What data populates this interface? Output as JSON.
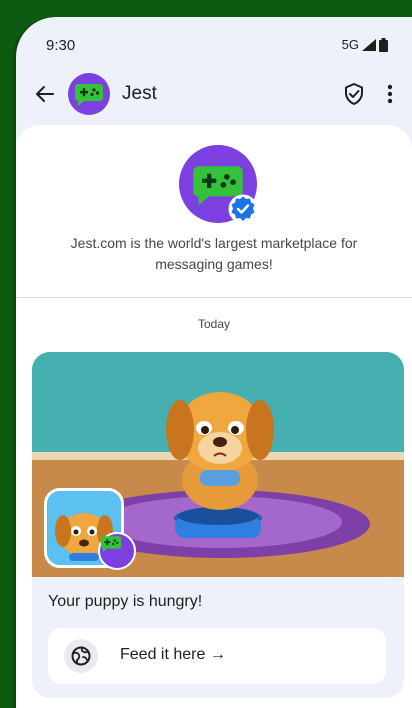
{
  "status_bar": {
    "time": "9:30",
    "network": "5G",
    "signal_icon": "signal-icon",
    "battery_icon": "battery-icon"
  },
  "appbar": {
    "title": "Jest",
    "back_icon": "arrow-back-icon",
    "shield_icon": "shield-check-icon",
    "more_icon": "more-vert-icon"
  },
  "profile": {
    "description": "Jest.com is the world's largest marketplace for messaging games!",
    "verified_icon": "verified-badge-icon"
  },
  "conversation": {
    "date_label": "Today",
    "card": {
      "title": "Your puppy is hungry!",
      "action_label": "Feed it here →",
      "action_icon": "globe-icon"
    }
  },
  "colors": {
    "brand_purple": "#7c3fe0",
    "brand_green": "#34c23b",
    "verified_blue": "#1a73e8",
    "background_green": "#1b7a1f"
  }
}
